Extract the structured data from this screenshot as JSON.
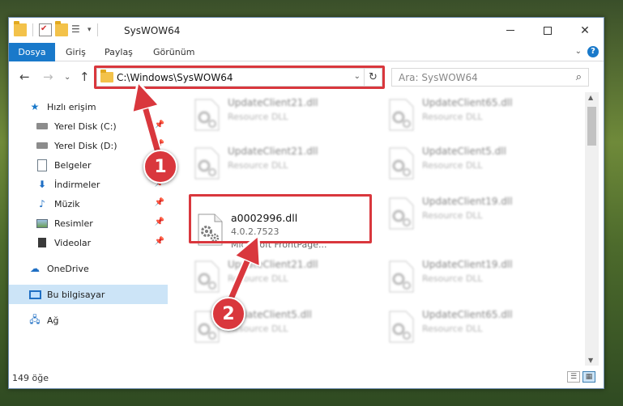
{
  "window": {
    "title": "SysWOW64"
  },
  "ribbon": {
    "tabs": [
      "Dosya",
      "Giriş",
      "Paylaş",
      "Görünüm"
    ],
    "help": "?"
  },
  "nav": {
    "address": "C:\\Windows\\SysWOW64",
    "search_placeholder": "Ara: SysWOW64"
  },
  "sidebar": {
    "items": [
      {
        "label": "Hızlı erişim",
        "icon": "star-icon"
      },
      {
        "label": "Yerel Disk (C:)",
        "icon": "drive-icon",
        "pinned": true
      },
      {
        "label": "Yerel Disk (D:)",
        "icon": "drive-icon",
        "pinned": true
      },
      {
        "label": "Belgeler",
        "icon": "documents-icon",
        "pinned": true
      },
      {
        "label": "İndirmeler",
        "icon": "downloads-icon",
        "pinned": true
      },
      {
        "label": "Müzik",
        "icon": "music-icon",
        "pinned": true
      },
      {
        "label": "Resimler",
        "icon": "pictures-icon",
        "pinned": true
      },
      {
        "label": "Videolar",
        "icon": "videos-icon",
        "pinned": true
      },
      {
        "label": "OneDrive",
        "icon": "onedrive-icon"
      },
      {
        "label": "Bu bilgisayar",
        "icon": "this-pc-icon",
        "selected": true
      },
      {
        "label": "Ağ",
        "icon": "network-icon"
      }
    ]
  },
  "files": [
    {
      "name": "UpdateClient21.dll",
      "type": "Resource DLL"
    },
    {
      "name": "UpdateClient65.dll",
      "type": "Resource DLL"
    },
    {
      "name": "UpdateClient21.dll",
      "type": "Resource DLL"
    },
    {
      "name": "UpdateClient5.dll",
      "type": "Resource DLL"
    },
    {
      "name": "a0002996.dll",
      "version": "4.0.2.7523",
      "type": "Microsoft FrontPage...",
      "highlighted": true
    },
    {
      "name": "UpdateClient19.dll",
      "type": "Resource DLL"
    },
    {
      "name": "UpdateClient21.dll",
      "type": "Resource DLL"
    },
    {
      "name": "UpdateClient19.dll",
      "type": "Resource DLL"
    },
    {
      "name": "UpdateClient5.dll",
      "type": "Resource DLL"
    },
    {
      "name": "UpdateClient65.dll",
      "type": "Resource DLL"
    }
  ],
  "status": {
    "item_count": "149 öğe"
  },
  "annotations": {
    "step1": "1",
    "step2": "2",
    "color": "#d9373d"
  }
}
